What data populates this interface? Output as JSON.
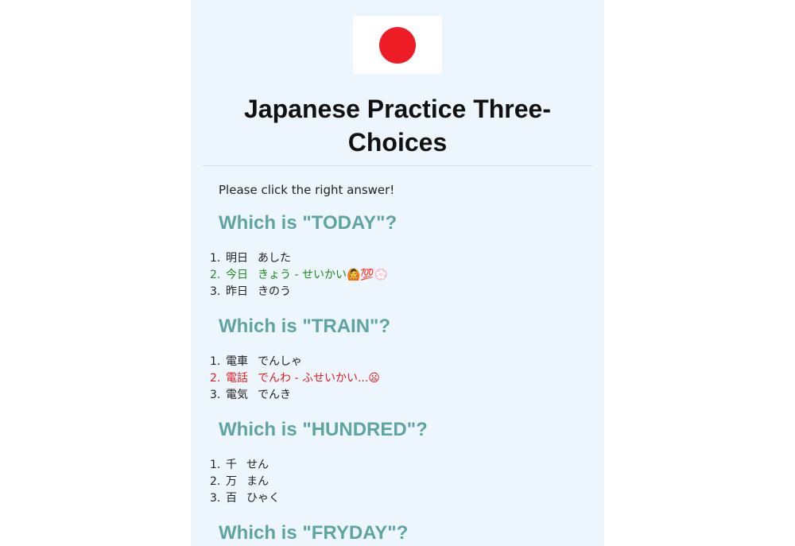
{
  "flag": {
    "icon": "japan-flag-icon",
    "red": "#ee1c25"
  },
  "title": "Japanese Practice Three-Choices",
  "intro": "Please click the right answer!",
  "questions": [
    {
      "prompt": "Which is \"TODAY\"?",
      "choices": [
        {
          "num": "1.",
          "kanji": "明日",
          "kana": "あした",
          "feedback": "",
          "state": "normal"
        },
        {
          "num": "2.",
          "kanji": "今日",
          "kana": "きょう",
          "feedback": " - せいかい🙆💯💮",
          "state": "correct"
        },
        {
          "num": "3.",
          "kanji": "昨日",
          "kana": "きのう",
          "feedback": "",
          "state": "normal"
        }
      ]
    },
    {
      "prompt": "Which is \"TRAIN\"?",
      "choices": [
        {
          "num": "1.",
          "kanji": "電車",
          "kana": "でんしゃ",
          "feedback": "",
          "state": "normal"
        },
        {
          "num": "2.",
          "kanji": "電話",
          "kana": "でんわ",
          "feedback": " - ふせいかい...😦",
          "state": "wrong"
        },
        {
          "num": "3.",
          "kanji": "電気",
          "kana": "でんき",
          "feedback": "",
          "state": "normal"
        }
      ]
    },
    {
      "prompt": "Which is \"HUNDRED\"?",
      "choices": [
        {
          "num": "1.",
          "kanji": "千",
          "kana": "せん",
          "feedback": "",
          "state": "normal"
        },
        {
          "num": "2.",
          "kanji": "万",
          "kana": "まん",
          "feedback": "",
          "state": "normal"
        },
        {
          "num": "3.",
          "kanji": "百",
          "kana": "ひゃく",
          "feedback": "",
          "state": "normal"
        }
      ]
    },
    {
      "prompt": "Which is \"FRYDAY\"?",
      "choices": []
    }
  ],
  "colors": {
    "question": "#5fa3a3",
    "correct": "#1f8a1f",
    "wrong": "#e02020",
    "background": "#eef6fd"
  }
}
